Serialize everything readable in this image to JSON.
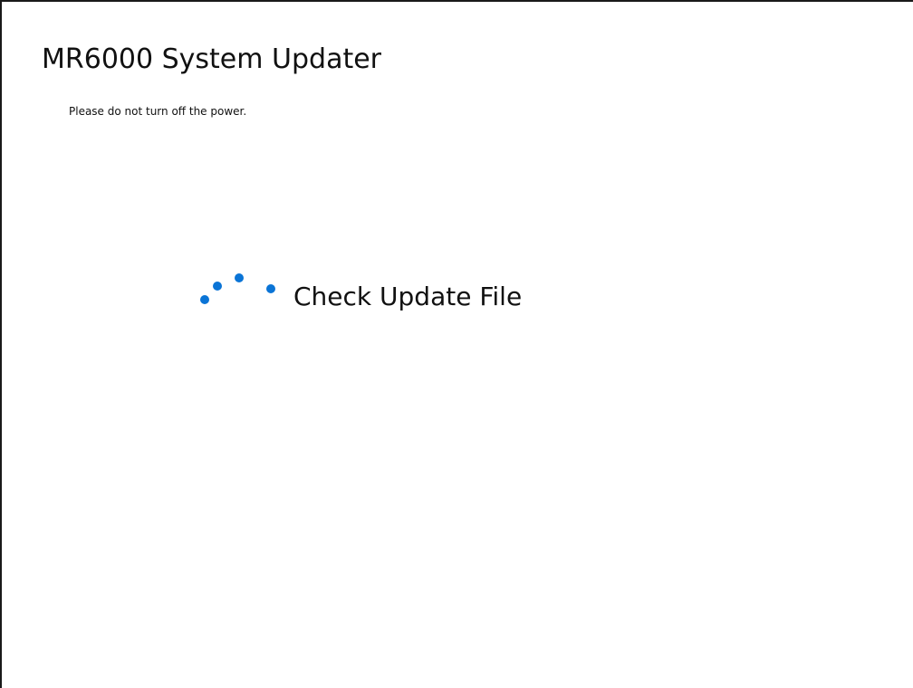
{
  "window": {
    "title": "MR6000 System Updater",
    "message": "Please do not turn off the power."
  },
  "status": {
    "text": "Check Update File",
    "indicator_icon": "loading-spinner-icon",
    "accent_color": "#0a74d6"
  }
}
